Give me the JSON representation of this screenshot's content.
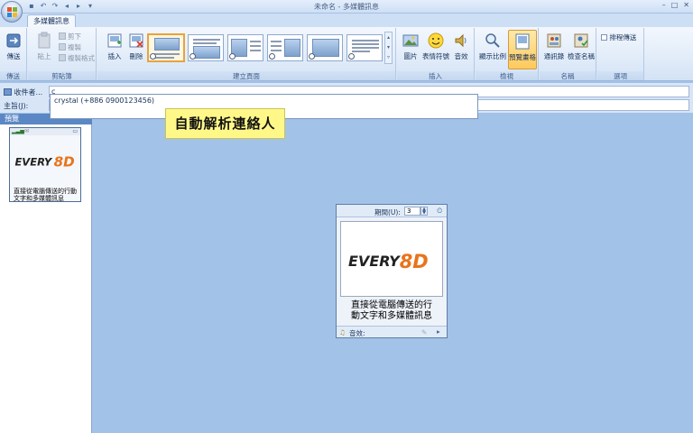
{
  "window": {
    "title": "未命名 - 多媒體訊息",
    "controls": [
      "–",
      "□",
      "✕"
    ]
  },
  "tabs": [
    {
      "label": "多媒體訊息"
    }
  ],
  "ribbon": {
    "send": {
      "button": "傳送",
      "group": "傳送"
    },
    "clipboard": {
      "paste": "貼上",
      "cut": "剪下",
      "copy": "複製",
      "format_painter": "複製格式",
      "group": "剪貼簿"
    },
    "pages": {
      "insert": "插入",
      "delete": "刪除",
      "group": "建立頁面"
    },
    "insert": {
      "picture": "圖片",
      "emoticon": "表情符號",
      "sound": "音效",
      "group": "插入"
    },
    "view": {
      "zoom": "顯示比例",
      "preview": "預覽畫格",
      "group": "檢視"
    },
    "names": {
      "contacts": "通訊錄",
      "check_names": "檢查名稱",
      "group": "名稱"
    },
    "options": {
      "schedule_send": "排程傳送",
      "group": "選項"
    }
  },
  "address": {
    "to_label": "收件者...",
    "to_value": "c",
    "subject_label": "主旨(J):",
    "subject_value": ""
  },
  "autocomplete": {
    "suggestion": "crystal (+886 0900123456)"
  },
  "callout": {
    "text": "自動解析連絡人"
  },
  "preview_pane": {
    "tab": "預覽",
    "thumb_text": "直接從電腦傳送的行動文字和多媒體訊息"
  },
  "slide": {
    "duration_label": "期間(U):",
    "duration_value": "3",
    "logo": "EVERY8D",
    "text_line1": "直接從電腦傳送的行",
    "text_line2": "動文字和多媒體訊息",
    "sound_label": "音效:"
  },
  "colors": {
    "accent_orange": "#e8741c",
    "logo_dark": "#222222",
    "ribbon_blue": "#cddff5",
    "workspace": "#a3c2e8"
  }
}
